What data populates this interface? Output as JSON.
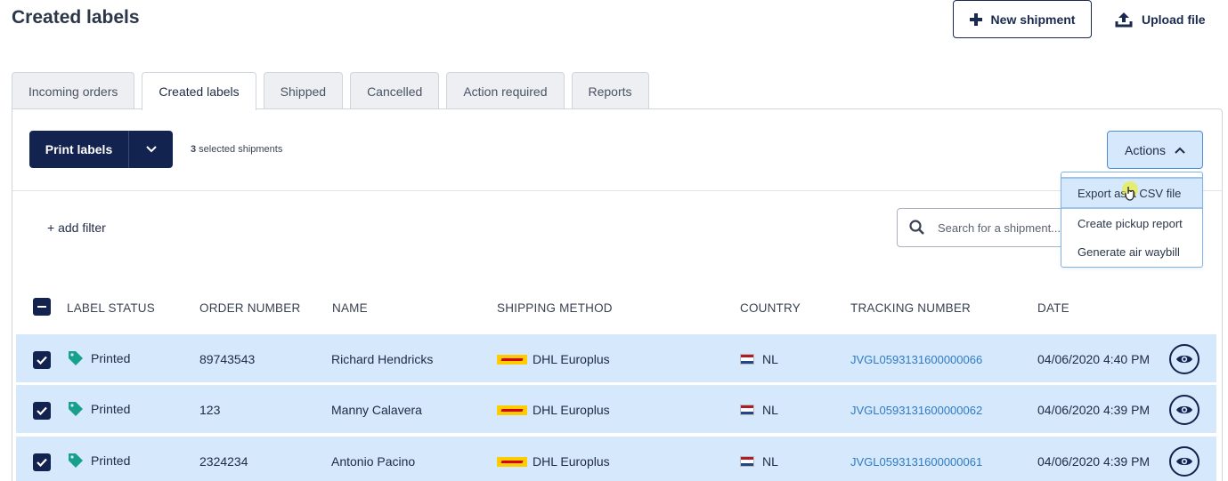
{
  "page": {
    "title": "Created labels"
  },
  "header": {
    "new_shipment_label": "New shipment",
    "upload_label": "Upload file"
  },
  "tabs": [
    {
      "label": "Incoming orders",
      "active": false
    },
    {
      "label": "Created labels",
      "active": true
    },
    {
      "label": "Shipped",
      "active": false
    },
    {
      "label": "Cancelled",
      "active": false
    },
    {
      "label": "Action required",
      "active": false
    },
    {
      "label": "Reports",
      "active": false
    }
  ],
  "toolbar": {
    "print_label": "Print labels",
    "selected_count": "3",
    "selected_text": " selected shipments",
    "actions_label": "Actions"
  },
  "actions_menu": [
    {
      "label": "Export as a CSV file"
    },
    {
      "label": "Create pickup report"
    },
    {
      "label": "Generate air waybill"
    }
  ],
  "filter": {
    "add_label": "+ add filter"
  },
  "search": {
    "placeholder": "Search for a shipment..."
  },
  "table": {
    "columns": [
      "LABEL STATUS",
      "ORDER NUMBER",
      "NAME",
      "SHIPPING METHOD",
      "COUNTRY",
      "TRACKING NUMBER",
      "DATE"
    ],
    "rows": [
      {
        "status": "Printed",
        "order": "89743543",
        "name": "Richard Hendricks",
        "method": "DHL Europlus",
        "country": "NL",
        "tracking": "JVGL0593131600000066",
        "date": "04/06/2020 4:40 PM"
      },
      {
        "status": "Printed",
        "order": "123",
        "name": "Manny Calavera",
        "method": "DHL Europlus",
        "country": "NL",
        "tracking": "JVGL0593131600000062",
        "date": "04/06/2020 4:39 PM"
      },
      {
        "status": "Printed",
        "order": "2324234",
        "name": "Antonio Pacino",
        "method": "DHL Europlus",
        "country": "NL",
        "tracking": "JVGL0593131600000061",
        "date": "04/06/2020 4:39 PM"
      }
    ]
  },
  "colors": {
    "navy": "#13234f",
    "row_selected": "#d6e8fb",
    "link": "#2f7bc4",
    "tag": "#17a08a"
  },
  "icons": {
    "new": "plus-icon",
    "upload": "upload-icon",
    "dropdown": "chevron-down-icon",
    "actions": "chevron-up-icon",
    "search": "search-icon",
    "status": "tag-icon",
    "view": "eye-icon"
  }
}
